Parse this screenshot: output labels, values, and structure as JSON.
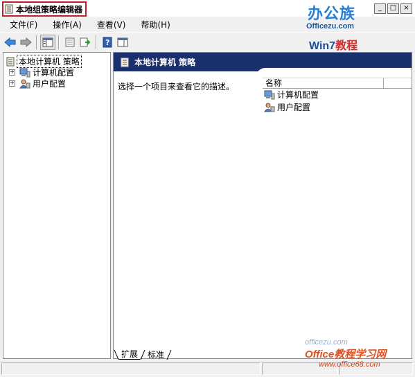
{
  "window": {
    "title": "本地组策略编辑器",
    "controls": [
      "_",
      "□",
      "×"
    ]
  },
  "menu": {
    "file": "文件(F)",
    "action": "操作(A)",
    "view": "查看(V)",
    "help": "帮助(H)"
  },
  "toolbar": {
    "icons": [
      "back-arrow-icon",
      "forward-arrow-icon",
      "show-hide-tree-icon",
      "properties-icon",
      "export-list-icon",
      "help-icon",
      "show-hide-action-pane-icon"
    ]
  },
  "tree": {
    "root": "本地计算机 策略",
    "nodes": [
      {
        "label": "计算机配置",
        "expander": "+"
      },
      {
        "label": "用户配置",
        "expander": "+"
      }
    ]
  },
  "main": {
    "header_title": "本地计算机 策略",
    "description": "选择一个项目来查看它的描述。",
    "column_name": "名称",
    "items": [
      "计算机配置",
      "用户配置"
    ],
    "tabs": [
      "扩展",
      "标准"
    ]
  },
  "watermarks": {
    "top_brand": "办公族",
    "top_url": "Officezu.com",
    "top_win7": "Win7",
    "top_jiaocheng": "教程",
    "bottom_faint": "officezu.com",
    "bottom_brand": "Office教程学习网",
    "bottom_url": "www.office68.com"
  },
  "colors": {
    "header_bg": "#1a2f6e",
    "title_highlight": "#c0202a"
  }
}
